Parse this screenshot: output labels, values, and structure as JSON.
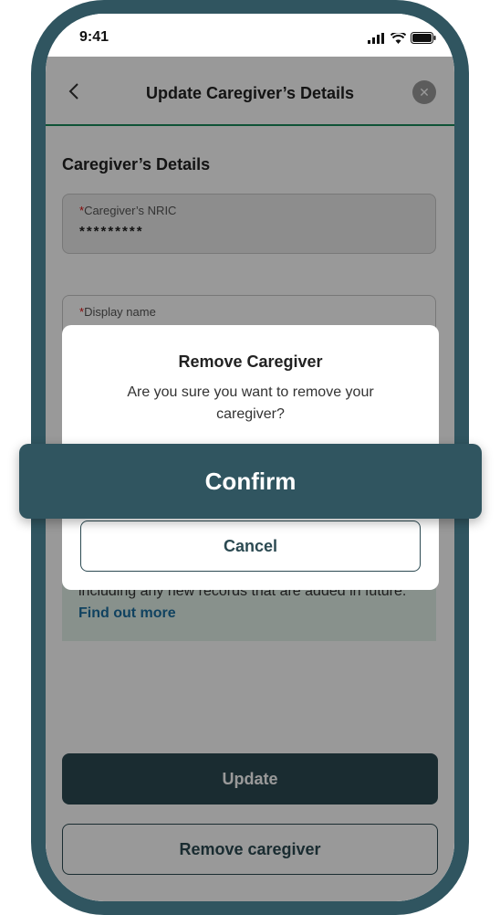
{
  "status_bar": {
    "time": "9:41"
  },
  "header": {
    "title": "Update Caregiver’s Details"
  },
  "section": {
    "title": "Caregiver’s Details"
  },
  "fields": {
    "nric": {
      "required_mark": "*",
      "label": "Caregiver’s NRIC",
      "value": "*********"
    },
    "display_name": {
      "required_mark": "*",
      "label": "Display name"
    }
  },
  "info": {
    "text": "including any new records that are added in future.",
    "link": "Find out more"
  },
  "buttons": {
    "update": "Update",
    "remove": "Remove caregiver"
  },
  "dialog": {
    "title": "Remove Caregiver",
    "message": "Are you sure you want to remove your caregiver?",
    "confirm": "Confirm",
    "cancel": "Cancel"
  },
  "colors": {
    "frame": "#305560",
    "primary": "#2c4a52",
    "accent_line": "#1a8a5a",
    "link": "#1b6fa0"
  }
}
